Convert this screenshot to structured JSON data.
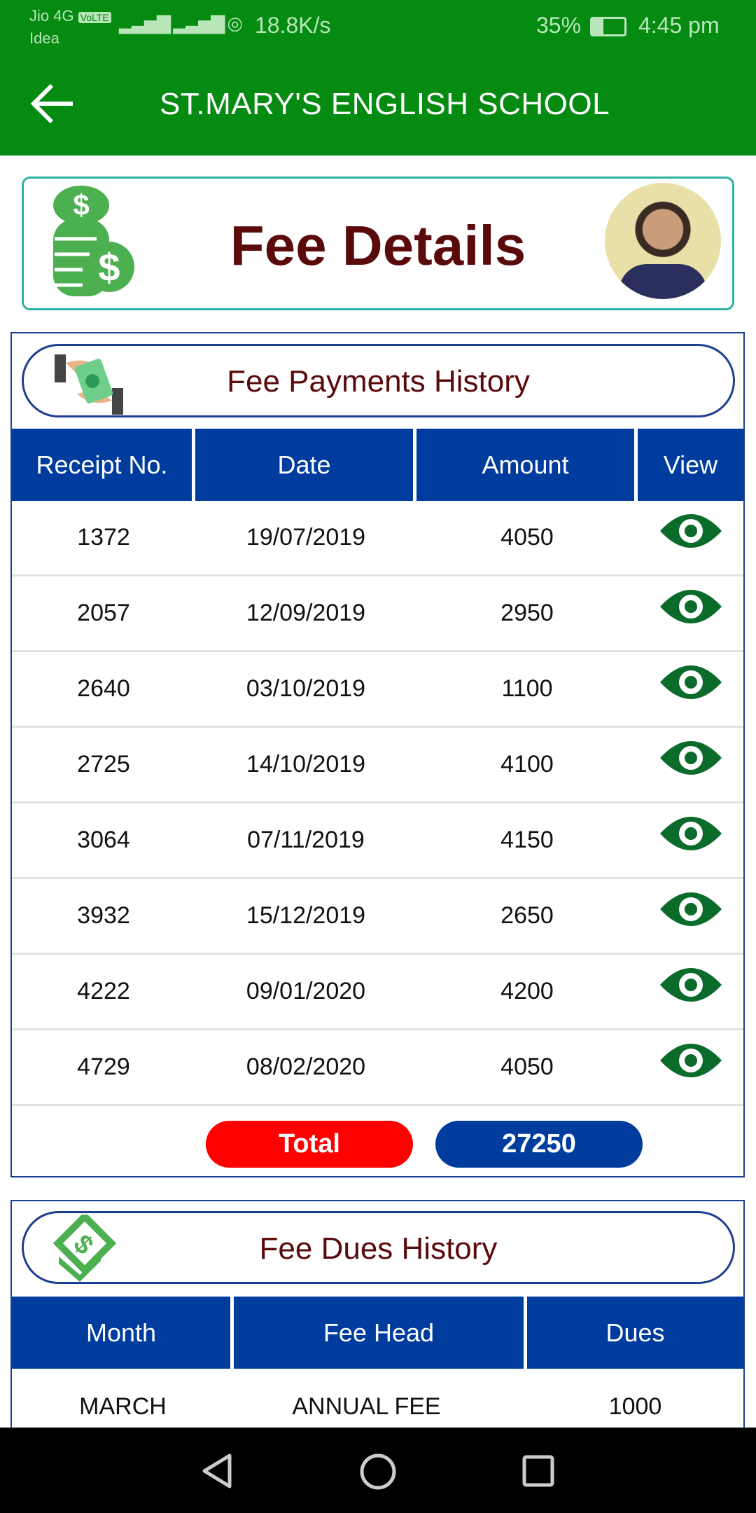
{
  "status_bar": {
    "carrier1": "Jio 4G",
    "volte": "VoLTE",
    "carrier2": "Idea",
    "network_speed": "18.8K/s",
    "battery": "35%",
    "battery_level": 0.35,
    "time": "4:45 pm"
  },
  "app_bar": {
    "title": "ST.MARY'S ENGLISH SCHOOL",
    "back_icon": "arrow-left-icon",
    "color": "#058a12"
  },
  "header_card": {
    "title": "Fee Details",
    "icon": "coins-dollar-icon",
    "avatar": "student-photo"
  },
  "payments": {
    "title": "Fee Payments History",
    "columns": [
      "Receipt No.",
      "Date",
      "Amount",
      "View"
    ],
    "rows": [
      {
        "receipt": "1372",
        "date": "19/07/2019",
        "amount": "4050"
      },
      {
        "receipt": "2057",
        "date": "12/09/2019",
        "amount": "2950"
      },
      {
        "receipt": "2640",
        "date": "03/10/2019",
        "amount": "1100"
      },
      {
        "receipt": "2725",
        "date": "14/10/2019",
        "amount": "4100"
      },
      {
        "receipt": "3064",
        "date": "07/11/2019",
        "amount": "4150"
      },
      {
        "receipt": "3932",
        "date": "15/12/2019",
        "amount": "2650"
      },
      {
        "receipt": "4222",
        "date": "09/01/2020",
        "amount": "4200"
      },
      {
        "receipt": "4729",
        "date": "08/02/2020",
        "amount": "4050"
      }
    ],
    "total_label": "Total",
    "total_value": "27250"
  },
  "dues": {
    "title": "Fee Dues History",
    "columns": [
      "Month",
      "Fee Head",
      "Dues"
    ],
    "rows": [
      {
        "month": "MARCH",
        "fee_head": "ANNUAL FEE",
        "dues": "1000"
      }
    ]
  },
  "colors": {
    "header_blue": "#003c9e",
    "total_red": "#ff0000",
    "eye_green": "#0b6b2b",
    "title_maroon": "#5a0a0a"
  }
}
